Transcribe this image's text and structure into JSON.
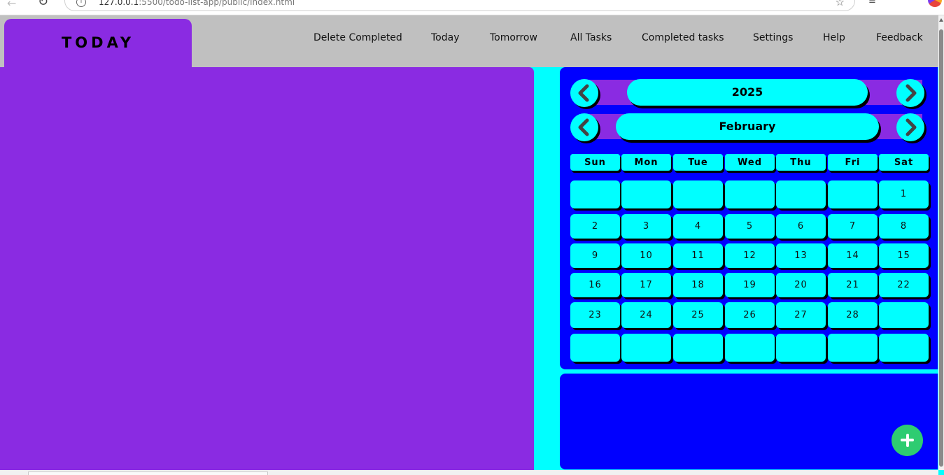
{
  "browser": {
    "url_host": "127.0.0.1",
    "url_rest": ":5500/todo-list-app/public/index.html"
  },
  "header": {
    "title": "TODAY",
    "nav": [
      "Delete Completed",
      "Today",
      "Tomorrow",
      "All Tasks",
      "Completed tasks",
      "Settings",
      "Help",
      "Feedback"
    ]
  },
  "calendar": {
    "year": "2025",
    "month": "February",
    "weekdays": [
      "Sun",
      "Mon",
      "Tue",
      "Wed",
      "Thu",
      "Fri",
      "Sat"
    ],
    "weeks": [
      [
        "",
        "",
        "",
        "",
        "",
        "",
        "1"
      ],
      [
        "2",
        "3",
        "4",
        "5",
        "6",
        "7",
        "8"
      ],
      [
        "9",
        "10",
        "11",
        "12",
        "13",
        "14",
        "15"
      ],
      [
        "16",
        "17",
        "18",
        "19",
        "20",
        "21",
        "22"
      ],
      [
        "23",
        "24",
        "25",
        "26",
        "27",
        "28",
        ""
      ],
      [
        "",
        "",
        "",
        "",
        "",
        "",
        ""
      ]
    ]
  },
  "icons": {
    "prev": "chevron-left-icon",
    "next": "chevron-right-icon",
    "add": "plus-icon"
  },
  "colors": {
    "accent_purple": "#8a2be2",
    "calendar_blue": "#0000ff",
    "cell_cyan": "#00ffff",
    "header_gray": "#c0c0c0",
    "add_button_green": "#2ecc71"
  }
}
